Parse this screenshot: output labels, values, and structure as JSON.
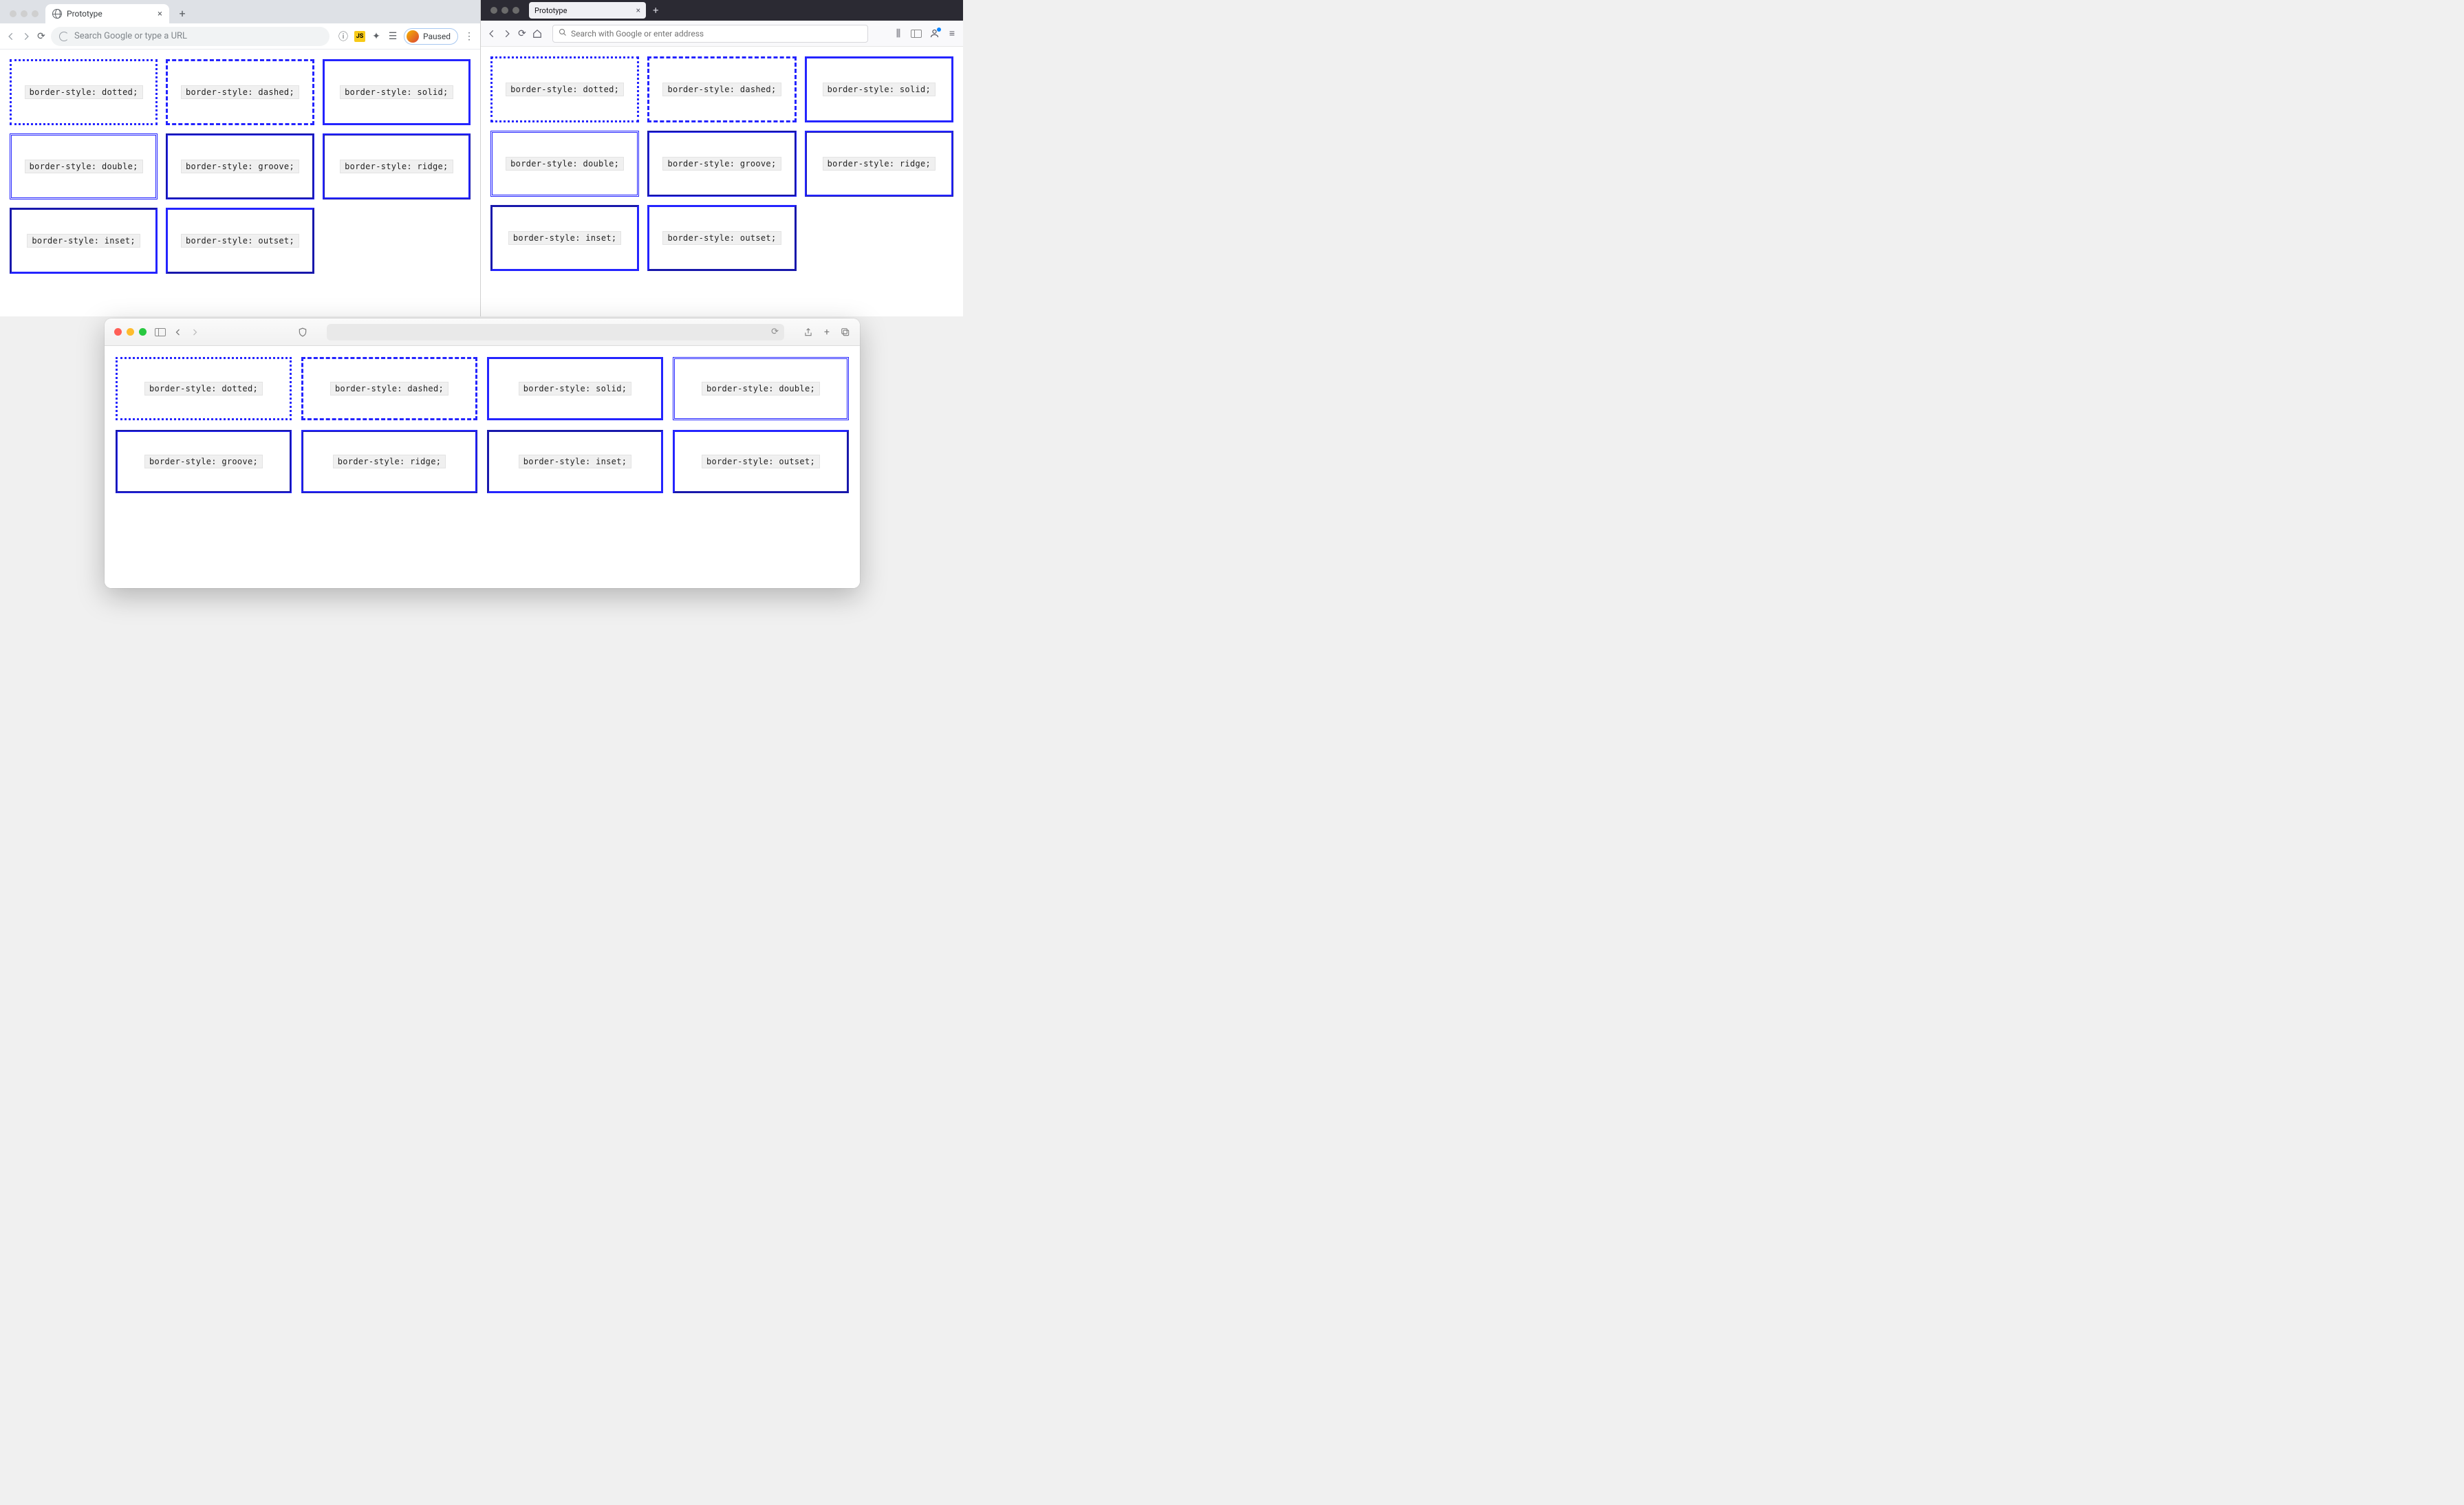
{
  "chrome": {
    "tab_title": "Prototype",
    "omnibox_placeholder": "Search Google or type a URL",
    "paused_label": "Paused"
  },
  "firefox": {
    "tab_title": "Prototype",
    "urlbar_placeholder": "Search with Google or enter address"
  },
  "border_styles": {
    "dotted": "border-style: dotted;",
    "dashed": "border-style: dashed;",
    "solid": "border-style: solid;",
    "double": "border-style: double;",
    "groove": "border-style: groove;",
    "ridge": "border-style: ridge;",
    "inset": "border-style: inset;",
    "outset": "border-style: outset;"
  }
}
